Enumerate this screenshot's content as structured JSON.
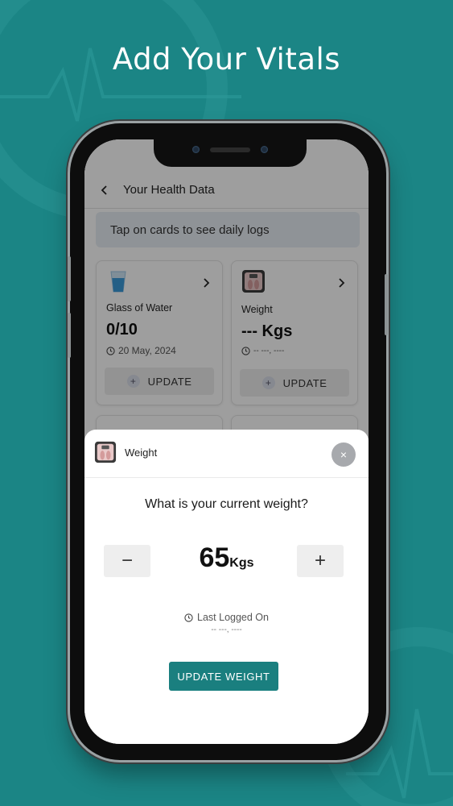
{
  "headline": "Add Your Vitals",
  "colors": {
    "background": "#1b8585",
    "accent": "#1a7f7f"
  },
  "appbar": {
    "back_icon": "chevron-left-icon",
    "title": "Your Health Data"
  },
  "banner": {
    "text": "Tap on cards to see daily logs"
  },
  "cards": [
    {
      "icon": "water-glass-icon",
      "label": "Glass of Water",
      "value": "0/10",
      "date": "20 May, 2024",
      "button": "UPDATE"
    },
    {
      "icon": "weight-scale-icon",
      "label": "Weight",
      "value": "--- Kgs",
      "date": "-- ---, ----",
      "button": "UPDATE"
    }
  ],
  "sheet": {
    "icon": "weight-scale-icon",
    "title": "Weight",
    "close_symbol": "×",
    "question": "What is your current weight?",
    "minus_symbol": "−",
    "plus_symbol": "+",
    "weight_value": "65",
    "weight_unit": "Kgs",
    "last_logged_label": "Last Logged On",
    "last_logged_value": "-- ---, ----",
    "submit_label": "UPDATE WEIGHT"
  }
}
